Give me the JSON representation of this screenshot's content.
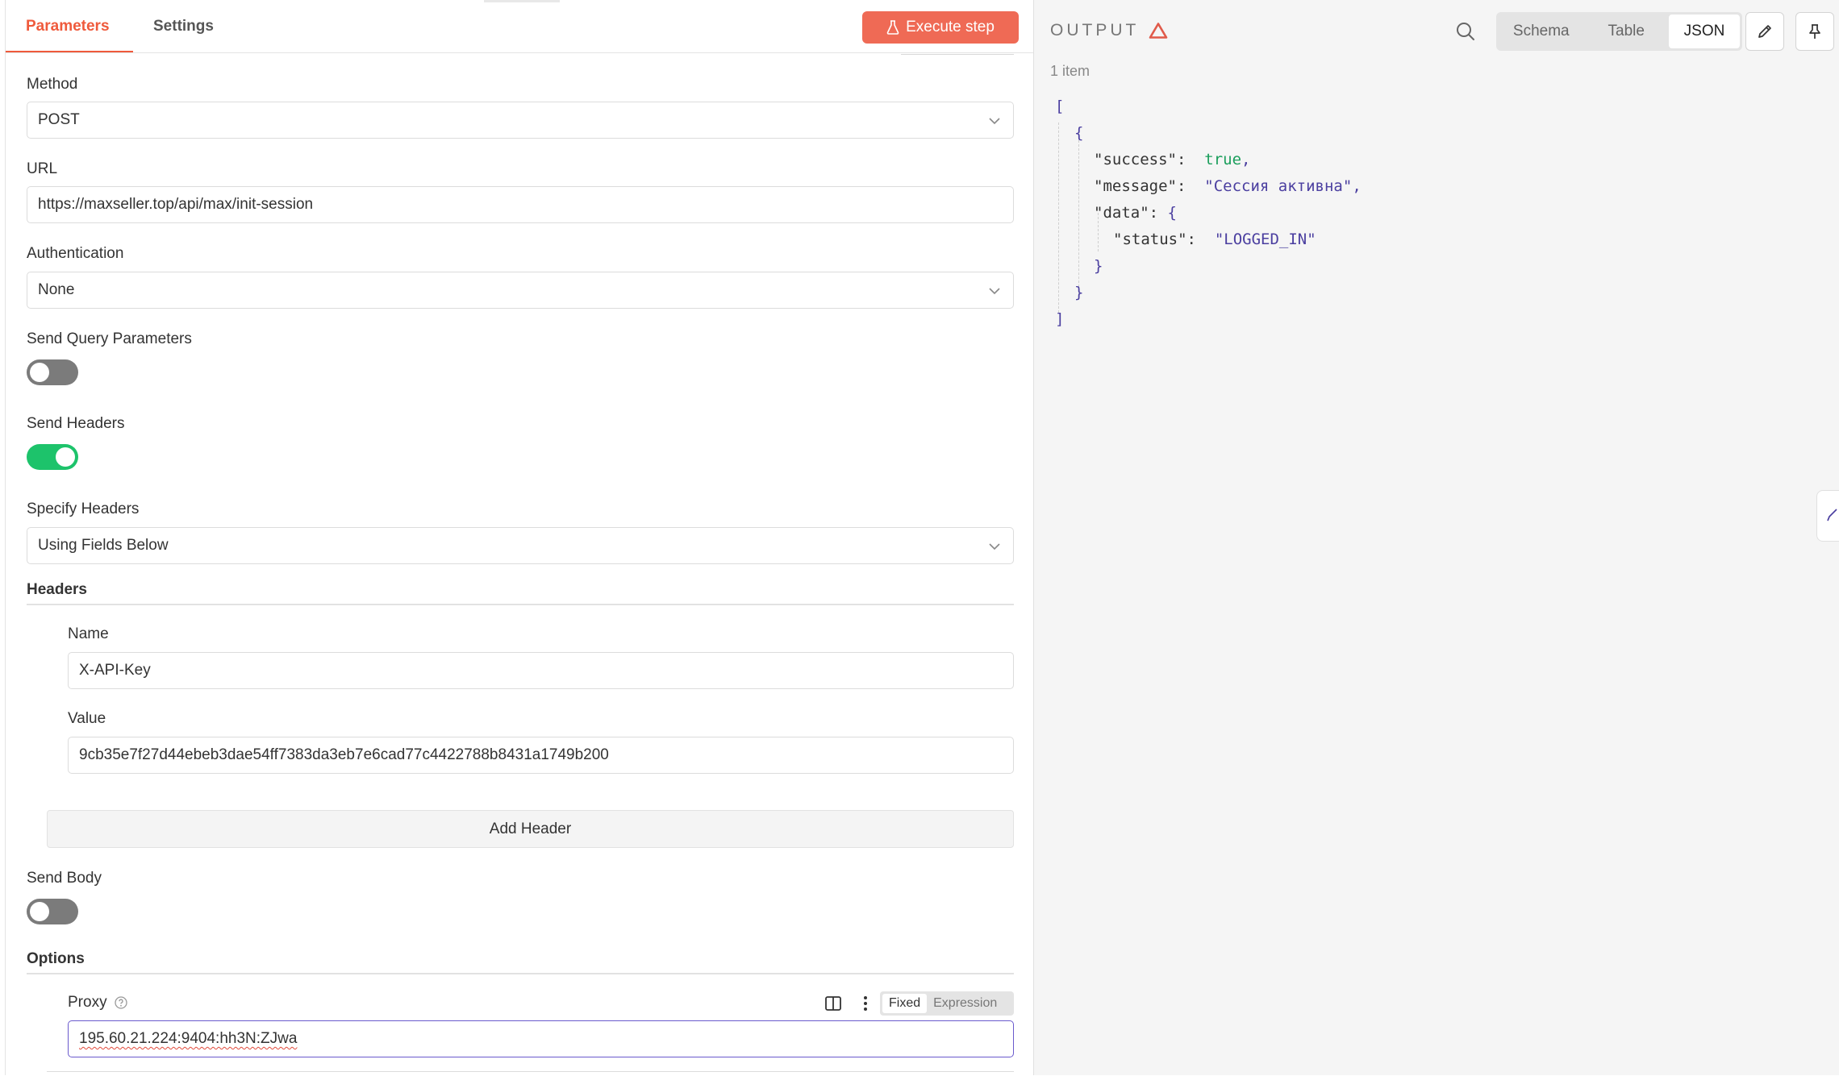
{
  "tabs": {
    "parameters": "Parameters",
    "settings": "Settings"
  },
  "execute_button": "Execute step",
  "form": {
    "method": {
      "label": "Method",
      "value": "POST"
    },
    "url": {
      "label": "URL",
      "value": "https://maxseller.top/api/max/init-session"
    },
    "authentication": {
      "label": "Authentication",
      "value": "None"
    },
    "send_query": {
      "label": "Send Query Parameters",
      "enabled": false
    },
    "send_headers": {
      "label": "Send Headers",
      "enabled": true
    },
    "specify_headers": {
      "label": "Specify Headers",
      "value": "Using Fields Below"
    },
    "headers": {
      "label": "Headers",
      "name_label": "Name",
      "name_value": "X-API-Key",
      "value_label": "Value",
      "value_value": "9cb35e7f27d44ebeb3dae54ff7383da3eb7e6cad77c4422788b8431a1749b200",
      "add_button": "Add Header"
    },
    "send_body": {
      "label": "Send Body",
      "enabled": false
    },
    "options": {
      "label": "Options",
      "proxy_label": "Proxy",
      "proxy_value": "195.60.21.224:9404:hh3N:ZJwa",
      "mode_fixed": "Fixed",
      "mode_expression": "Expression",
      "mode_selected": "Fixed"
    }
  },
  "output": {
    "title": "OUTPUT",
    "views": [
      "Schema",
      "Table",
      "JSON"
    ],
    "active_view": "JSON",
    "item_count": "1 item",
    "json": {
      "open_array": "[",
      "open_obj": "{",
      "success_key": "\"success\"",
      "success_val": "true",
      "message_key": "\"message\"",
      "message_val": "\"Сессия активна\"",
      "data_key": "\"data\"",
      "status_key": "\"status\"",
      "status_val": "\"LOGGED_IN\"",
      "close_inner": "}",
      "close_obj": "}",
      "close_array": "]"
    }
  },
  "colors": {
    "accent": "#ef5a3c",
    "execute_bg": "#ef6a55",
    "toggle_on": "#1dc36b",
    "toggle_off": "#7b7b7b",
    "json_string": "#4b3fa0",
    "json_bool": "#1a9e5b",
    "focus_border": "#6a5acd"
  },
  "icons": [
    "flask-icon",
    "chevron-down-icon",
    "help-circle-icon",
    "panel-icon",
    "more-vertical-icon",
    "warning-triangle-icon",
    "search-icon",
    "pencil-icon",
    "pin-icon"
  ]
}
